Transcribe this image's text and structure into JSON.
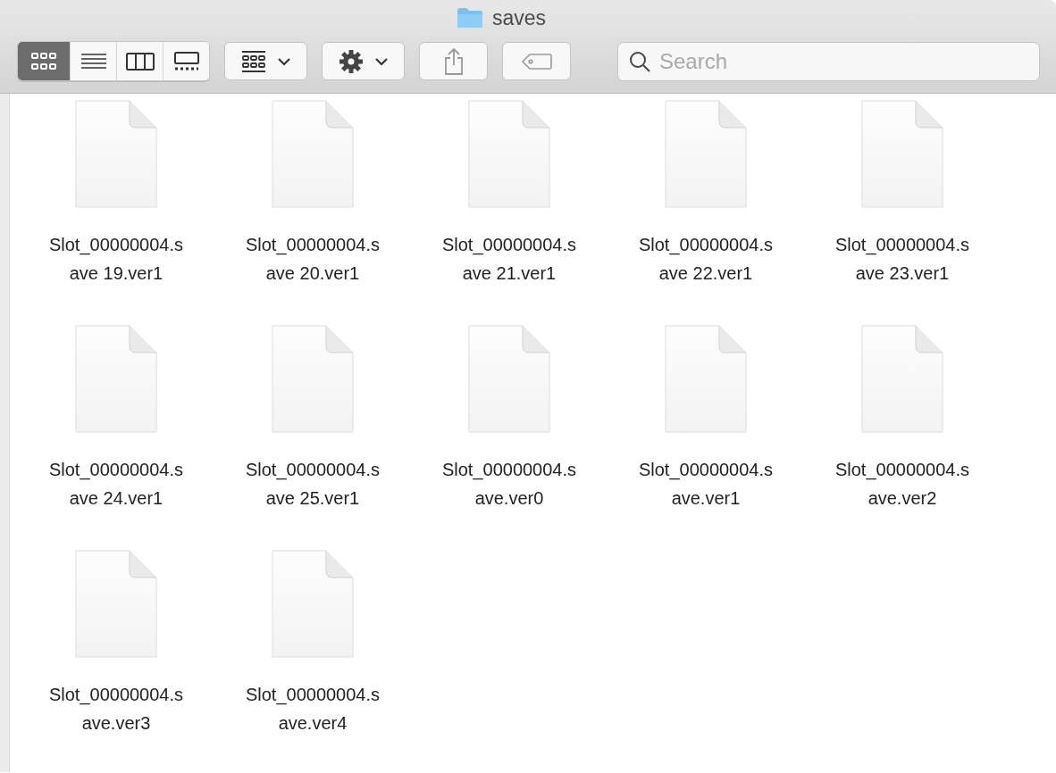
{
  "window": {
    "title": "saves"
  },
  "toolbar": {
    "view_modes": [
      {
        "kind": "icons",
        "selected": true
      },
      {
        "kind": "list",
        "selected": false
      },
      {
        "kind": "columns",
        "selected": false
      },
      {
        "kind": "gallery",
        "selected": false
      }
    ],
    "search": {
      "placeholder": "Search"
    }
  },
  "files": [
    {
      "name_lines": [
        "Slot_00000004.s",
        "ave 19.ver1"
      ]
    },
    {
      "name_lines": [
        "Slot_00000004.s",
        "ave 20.ver1"
      ]
    },
    {
      "name_lines": [
        "Slot_00000004.s",
        "ave 21.ver1"
      ]
    },
    {
      "name_lines": [
        "Slot_00000004.s",
        "ave 22.ver1"
      ]
    },
    {
      "name_lines": [
        "Slot_00000004.s",
        "ave 23.ver1"
      ]
    },
    {
      "name_lines": [
        "Slot_00000004.s",
        "ave 24.ver1"
      ]
    },
    {
      "name_lines": [
        "Slot_00000004.s",
        "ave 25.ver1"
      ]
    },
    {
      "name_lines": [
        "Slot_00000004.s",
        "ave.ver0"
      ]
    },
    {
      "name_lines": [
        "Slot_00000004.s",
        "ave.ver1"
      ]
    },
    {
      "name_lines": [
        "Slot_00000004.s",
        "ave.ver2"
      ]
    },
    {
      "name_lines": [
        "Slot_00000004.s",
        "ave.ver3"
      ]
    },
    {
      "name_lines": [
        "Slot_00000004.s",
        "ave.ver4"
      ]
    }
  ]
}
